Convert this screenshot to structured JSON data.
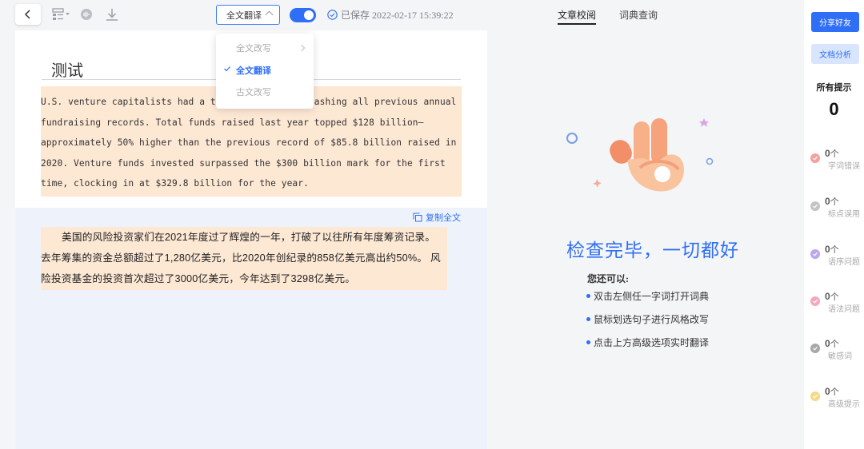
{
  "toolbar": {
    "mode_select": "全文翻译",
    "saved_text": "已保存 2022-02-17 15:39:22"
  },
  "dropdown": {
    "items": [
      {
        "label": "全文改写"
      },
      {
        "label": "全文翻译"
      },
      {
        "label": "古文改写"
      }
    ]
  },
  "document": {
    "title": "测试",
    "source_text": "U.S. venture capitalists had a tremendous 2021, smashing all previous annual fundraising records. Total funds raised last year topped $128 billion—approximately 50% higher than the previous record of $85.8 billion raised in 2020. Venture funds invested surpassed the $300 billion mark for the first time, clocking in at $329.8 billion for the year.",
    "copy_all": "复制全文",
    "translation": "美国的风险投资家们在2021年度过了辉煌的一年，打破了以往所有年度筹资记录。 去年筹集的资金总额超过了1,280亿美元，比2020年创纪录的858亿美元高出约50%。 风险投资基金的投资首次超过了3000亿美元，今年达到了3298亿美元。"
  },
  "review": {
    "tabs": [
      {
        "label": "文章校阅"
      },
      {
        "label": "词典查询"
      }
    ],
    "done_text": "检查完毕，一切都好",
    "tips_title": "您还可以:",
    "tips": [
      "双击左侧任一字词打开词典",
      "鼠标划选句子进行风格改写",
      "点击上方高级选项实时翻译"
    ]
  },
  "sidebar": {
    "share": "分享好友",
    "analysis": "文档分析",
    "all_tips_label": "所有提示",
    "all_tips_count": "0",
    "categories": [
      {
        "count": "0",
        "unit": "个",
        "label": "字词错误",
        "color": "#f08a8a"
      },
      {
        "count": "0",
        "unit": "个",
        "label": "标点误用",
        "color": "#b5b5b5"
      },
      {
        "count": "0",
        "unit": "个",
        "label": "语序问题",
        "color": "#b39ae8"
      },
      {
        "count": "0",
        "unit": "个",
        "label": "语法问题",
        "color": "#f09ab4"
      },
      {
        "count": "0",
        "unit": "个",
        "label": "敏感词",
        "color": "#9a9a9a"
      },
      {
        "count": "0",
        "unit": "个",
        "label": "高级提示",
        "color": "#f2d27a"
      }
    ]
  }
}
